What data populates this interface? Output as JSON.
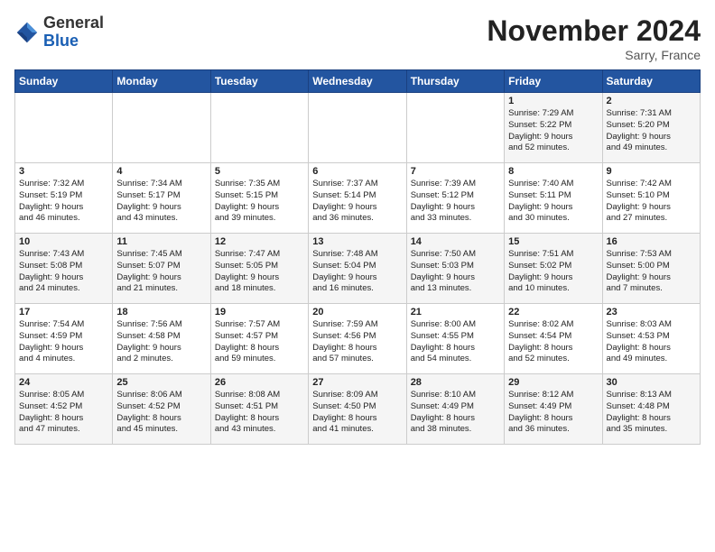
{
  "header": {
    "logo_general": "General",
    "logo_blue": "Blue",
    "title": "November 2024",
    "location": "Sarry, France"
  },
  "days_of_week": [
    "Sunday",
    "Monday",
    "Tuesday",
    "Wednesday",
    "Thursday",
    "Friday",
    "Saturday"
  ],
  "weeks": [
    [
      {
        "day": "",
        "info": ""
      },
      {
        "day": "",
        "info": ""
      },
      {
        "day": "",
        "info": ""
      },
      {
        "day": "",
        "info": ""
      },
      {
        "day": "",
        "info": ""
      },
      {
        "day": "1",
        "info": "Sunrise: 7:29 AM\nSunset: 5:22 PM\nDaylight: 9 hours\nand 52 minutes."
      },
      {
        "day": "2",
        "info": "Sunrise: 7:31 AM\nSunset: 5:20 PM\nDaylight: 9 hours\nand 49 minutes."
      }
    ],
    [
      {
        "day": "3",
        "info": "Sunrise: 7:32 AM\nSunset: 5:19 PM\nDaylight: 9 hours\nand 46 minutes."
      },
      {
        "day": "4",
        "info": "Sunrise: 7:34 AM\nSunset: 5:17 PM\nDaylight: 9 hours\nand 43 minutes."
      },
      {
        "day": "5",
        "info": "Sunrise: 7:35 AM\nSunset: 5:15 PM\nDaylight: 9 hours\nand 39 minutes."
      },
      {
        "day": "6",
        "info": "Sunrise: 7:37 AM\nSunset: 5:14 PM\nDaylight: 9 hours\nand 36 minutes."
      },
      {
        "day": "7",
        "info": "Sunrise: 7:39 AM\nSunset: 5:12 PM\nDaylight: 9 hours\nand 33 minutes."
      },
      {
        "day": "8",
        "info": "Sunrise: 7:40 AM\nSunset: 5:11 PM\nDaylight: 9 hours\nand 30 minutes."
      },
      {
        "day": "9",
        "info": "Sunrise: 7:42 AM\nSunset: 5:10 PM\nDaylight: 9 hours\nand 27 minutes."
      }
    ],
    [
      {
        "day": "10",
        "info": "Sunrise: 7:43 AM\nSunset: 5:08 PM\nDaylight: 9 hours\nand 24 minutes."
      },
      {
        "day": "11",
        "info": "Sunrise: 7:45 AM\nSunset: 5:07 PM\nDaylight: 9 hours\nand 21 minutes."
      },
      {
        "day": "12",
        "info": "Sunrise: 7:47 AM\nSunset: 5:05 PM\nDaylight: 9 hours\nand 18 minutes."
      },
      {
        "day": "13",
        "info": "Sunrise: 7:48 AM\nSunset: 5:04 PM\nDaylight: 9 hours\nand 16 minutes."
      },
      {
        "day": "14",
        "info": "Sunrise: 7:50 AM\nSunset: 5:03 PM\nDaylight: 9 hours\nand 13 minutes."
      },
      {
        "day": "15",
        "info": "Sunrise: 7:51 AM\nSunset: 5:02 PM\nDaylight: 9 hours\nand 10 minutes."
      },
      {
        "day": "16",
        "info": "Sunrise: 7:53 AM\nSunset: 5:00 PM\nDaylight: 9 hours\nand 7 minutes."
      }
    ],
    [
      {
        "day": "17",
        "info": "Sunrise: 7:54 AM\nSunset: 4:59 PM\nDaylight: 9 hours\nand 4 minutes."
      },
      {
        "day": "18",
        "info": "Sunrise: 7:56 AM\nSunset: 4:58 PM\nDaylight: 9 hours\nand 2 minutes."
      },
      {
        "day": "19",
        "info": "Sunrise: 7:57 AM\nSunset: 4:57 PM\nDaylight: 8 hours\nand 59 minutes."
      },
      {
        "day": "20",
        "info": "Sunrise: 7:59 AM\nSunset: 4:56 PM\nDaylight: 8 hours\nand 57 minutes."
      },
      {
        "day": "21",
        "info": "Sunrise: 8:00 AM\nSunset: 4:55 PM\nDaylight: 8 hours\nand 54 minutes."
      },
      {
        "day": "22",
        "info": "Sunrise: 8:02 AM\nSunset: 4:54 PM\nDaylight: 8 hours\nand 52 minutes."
      },
      {
        "day": "23",
        "info": "Sunrise: 8:03 AM\nSunset: 4:53 PM\nDaylight: 8 hours\nand 49 minutes."
      }
    ],
    [
      {
        "day": "24",
        "info": "Sunrise: 8:05 AM\nSunset: 4:52 PM\nDaylight: 8 hours\nand 47 minutes."
      },
      {
        "day": "25",
        "info": "Sunrise: 8:06 AM\nSunset: 4:52 PM\nDaylight: 8 hours\nand 45 minutes."
      },
      {
        "day": "26",
        "info": "Sunrise: 8:08 AM\nSunset: 4:51 PM\nDaylight: 8 hours\nand 43 minutes."
      },
      {
        "day": "27",
        "info": "Sunrise: 8:09 AM\nSunset: 4:50 PM\nDaylight: 8 hours\nand 41 minutes."
      },
      {
        "day": "28",
        "info": "Sunrise: 8:10 AM\nSunset: 4:49 PM\nDaylight: 8 hours\nand 38 minutes."
      },
      {
        "day": "29",
        "info": "Sunrise: 8:12 AM\nSunset: 4:49 PM\nDaylight: 8 hours\nand 36 minutes."
      },
      {
        "day": "30",
        "info": "Sunrise: 8:13 AM\nSunset: 4:48 PM\nDaylight: 8 hours\nand 35 minutes."
      }
    ]
  ]
}
